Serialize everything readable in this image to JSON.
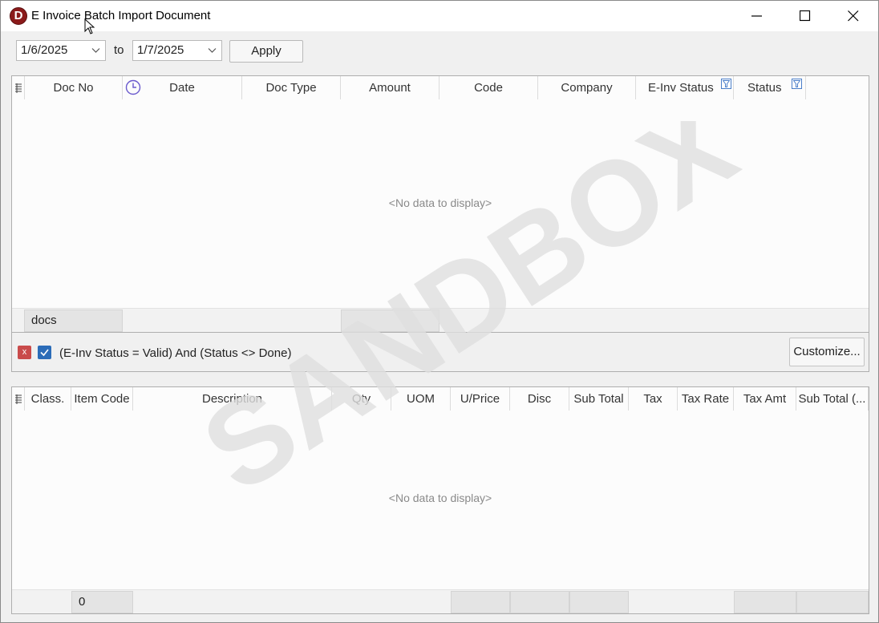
{
  "window": {
    "title": "E Invoice Batch Import Document",
    "icon": "app-logo-icon",
    "controls": [
      "minimize-icon",
      "maximize-icon",
      "close-icon"
    ]
  },
  "toolbar": {
    "date_from": "1/6/2025",
    "to_label": "to",
    "date_to": "1/7/2025",
    "apply_label": "Apply"
  },
  "grid1": {
    "columns": [
      "Doc No",
      "Date",
      "Doc Type",
      "Amount",
      "Code",
      "Company",
      "E-Inv Status",
      "Status"
    ],
    "empty_text": "<No data to display>",
    "footer_summary": "docs"
  },
  "filter": {
    "text": "(E-Inv Status = Valid) And (Status <> Done)",
    "remove_label": "x",
    "enabled": true,
    "customize_label": "Customize..."
  },
  "grid2": {
    "columns": [
      "Class.",
      "Item Code",
      "Description",
      "Qty",
      "UOM",
      "U/Price",
      "Disc",
      "Sub Total",
      "Tax",
      "Tax Rate",
      "Tax Amt",
      "Sub Total (..."
    ],
    "empty_text": "<No data to display>",
    "footer_count": "0"
  },
  "watermark": {
    "text": "SANDBOX",
    "color": "#dedede"
  }
}
